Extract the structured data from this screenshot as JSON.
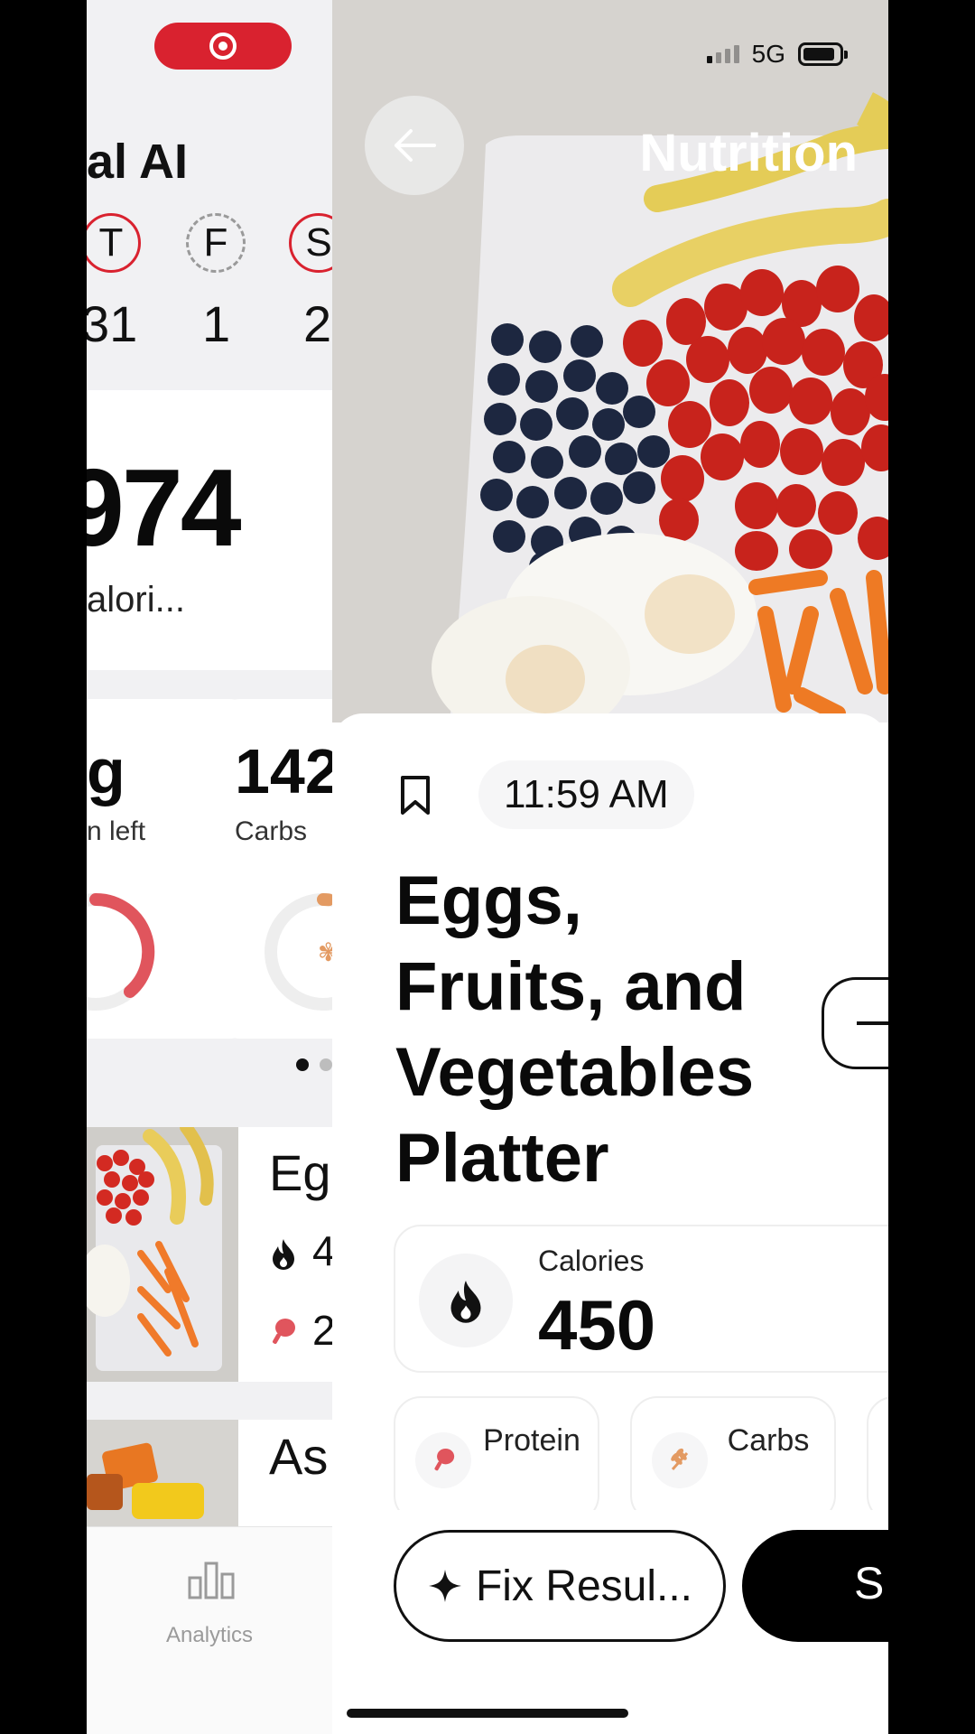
{
  "background_app": {
    "title": "al AI",
    "days": [
      {
        "letter": "T",
        "number": "31",
        "style": "red"
      },
      {
        "letter": "F",
        "number": "1",
        "style": "dash"
      },
      {
        "letter": "S",
        "number": "2",
        "style": "red"
      }
    ],
    "calories_value": "974",
    "calories_label": "alori...",
    "macro_left": {
      "value": "g",
      "label": "n left"
    },
    "macro_right": {
      "value": "142",
      "label": "Carbs"
    },
    "food_rows": [
      {
        "name": "Eg",
        "calories": "4",
        "protein": "2"
      },
      {
        "name": "As"
      }
    ],
    "tab_label": "Analytics",
    "colors": {
      "accent": "#d9222f"
    }
  },
  "status_bar": {
    "network": "5G"
  },
  "nutrition": {
    "nav_title": "Nutrition",
    "time": "11:59 AM",
    "meal_title": "Eggs, Fruits, and Vegetables Platter",
    "calories_label": "Calories",
    "calories_value": "450",
    "protein_label": "Protein",
    "carbs_label": "Carbs",
    "fix_button": "Fix Resul...",
    "save_button": "S"
  },
  "icons": {
    "back": "arrow-left-icon",
    "bookmark": "bookmark-icon",
    "calories": "flame-icon",
    "protein": "drumstick-icon",
    "carbs": "wheat-icon",
    "fix": "sparkle-icon",
    "analytics": "bar-chart-icon"
  }
}
